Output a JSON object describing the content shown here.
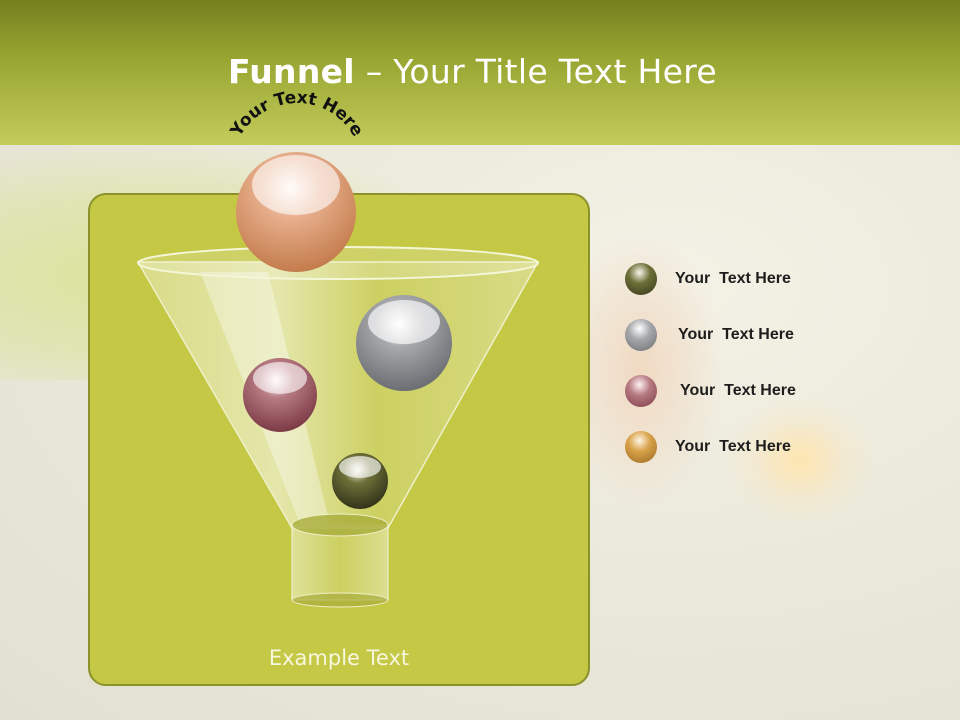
{
  "slide": {
    "title_bold": "Funnel",
    "title_rest": " – Your Title Text Here",
    "arc_label": "Your Text Here",
    "example_text": "Example Text"
  },
  "legend": [
    {
      "label": "Your  Text Here",
      "color": "#5a5d2e"
    },
    {
      "label": "Your  Text Here",
      "color": "#8a8e92"
    },
    {
      "label": "Your  Text Here",
      "color": "#a25a64"
    },
    {
      "label": "Your  Text Here",
      "color": "#d9a24a"
    }
  ],
  "colors": {
    "header_top": "#77801f",
    "header_bottom": "#c4cc5b",
    "panel_fill": "#c4c845",
    "panel_border": "#8d912a"
  }
}
